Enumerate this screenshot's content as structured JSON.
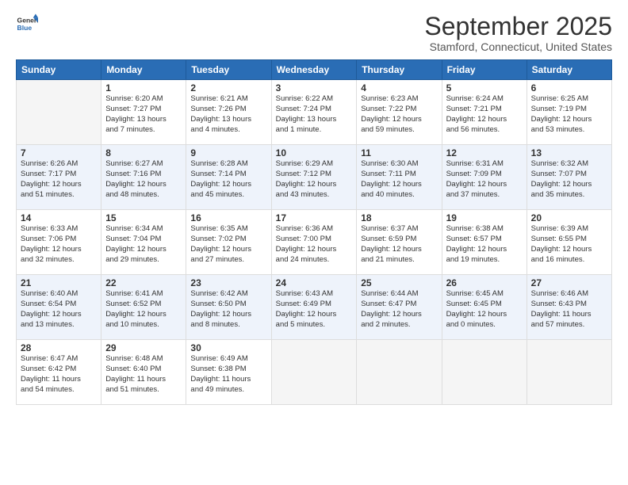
{
  "logo": {
    "line1": "General",
    "line2": "Blue"
  },
  "title": "September 2025",
  "subtitle": "Stamford, Connecticut, United States",
  "days_header": [
    "Sunday",
    "Monday",
    "Tuesday",
    "Wednesday",
    "Thursday",
    "Friday",
    "Saturday"
  ],
  "weeks": [
    [
      {
        "date": "",
        "info": ""
      },
      {
        "date": "1",
        "info": "Sunrise: 6:20 AM\nSunset: 7:27 PM\nDaylight: 13 hours\nand 7 minutes."
      },
      {
        "date": "2",
        "info": "Sunrise: 6:21 AM\nSunset: 7:26 PM\nDaylight: 13 hours\nand 4 minutes."
      },
      {
        "date": "3",
        "info": "Sunrise: 6:22 AM\nSunset: 7:24 PM\nDaylight: 13 hours\nand 1 minute."
      },
      {
        "date": "4",
        "info": "Sunrise: 6:23 AM\nSunset: 7:22 PM\nDaylight: 12 hours\nand 59 minutes."
      },
      {
        "date": "5",
        "info": "Sunrise: 6:24 AM\nSunset: 7:21 PM\nDaylight: 12 hours\nand 56 minutes."
      },
      {
        "date": "6",
        "info": "Sunrise: 6:25 AM\nSunset: 7:19 PM\nDaylight: 12 hours\nand 53 minutes."
      }
    ],
    [
      {
        "date": "7",
        "info": "Sunrise: 6:26 AM\nSunset: 7:17 PM\nDaylight: 12 hours\nand 51 minutes."
      },
      {
        "date": "8",
        "info": "Sunrise: 6:27 AM\nSunset: 7:16 PM\nDaylight: 12 hours\nand 48 minutes."
      },
      {
        "date": "9",
        "info": "Sunrise: 6:28 AM\nSunset: 7:14 PM\nDaylight: 12 hours\nand 45 minutes."
      },
      {
        "date": "10",
        "info": "Sunrise: 6:29 AM\nSunset: 7:12 PM\nDaylight: 12 hours\nand 43 minutes."
      },
      {
        "date": "11",
        "info": "Sunrise: 6:30 AM\nSunset: 7:11 PM\nDaylight: 12 hours\nand 40 minutes."
      },
      {
        "date": "12",
        "info": "Sunrise: 6:31 AM\nSunset: 7:09 PM\nDaylight: 12 hours\nand 37 minutes."
      },
      {
        "date": "13",
        "info": "Sunrise: 6:32 AM\nSunset: 7:07 PM\nDaylight: 12 hours\nand 35 minutes."
      }
    ],
    [
      {
        "date": "14",
        "info": "Sunrise: 6:33 AM\nSunset: 7:06 PM\nDaylight: 12 hours\nand 32 minutes."
      },
      {
        "date": "15",
        "info": "Sunrise: 6:34 AM\nSunset: 7:04 PM\nDaylight: 12 hours\nand 29 minutes."
      },
      {
        "date": "16",
        "info": "Sunrise: 6:35 AM\nSunset: 7:02 PM\nDaylight: 12 hours\nand 27 minutes."
      },
      {
        "date": "17",
        "info": "Sunrise: 6:36 AM\nSunset: 7:00 PM\nDaylight: 12 hours\nand 24 minutes."
      },
      {
        "date": "18",
        "info": "Sunrise: 6:37 AM\nSunset: 6:59 PM\nDaylight: 12 hours\nand 21 minutes."
      },
      {
        "date": "19",
        "info": "Sunrise: 6:38 AM\nSunset: 6:57 PM\nDaylight: 12 hours\nand 19 minutes."
      },
      {
        "date": "20",
        "info": "Sunrise: 6:39 AM\nSunset: 6:55 PM\nDaylight: 12 hours\nand 16 minutes."
      }
    ],
    [
      {
        "date": "21",
        "info": "Sunrise: 6:40 AM\nSunset: 6:54 PM\nDaylight: 12 hours\nand 13 minutes."
      },
      {
        "date": "22",
        "info": "Sunrise: 6:41 AM\nSunset: 6:52 PM\nDaylight: 12 hours\nand 10 minutes."
      },
      {
        "date": "23",
        "info": "Sunrise: 6:42 AM\nSunset: 6:50 PM\nDaylight: 12 hours\nand 8 minutes."
      },
      {
        "date": "24",
        "info": "Sunrise: 6:43 AM\nSunset: 6:49 PM\nDaylight: 12 hours\nand 5 minutes."
      },
      {
        "date": "25",
        "info": "Sunrise: 6:44 AM\nSunset: 6:47 PM\nDaylight: 12 hours\nand 2 minutes."
      },
      {
        "date": "26",
        "info": "Sunrise: 6:45 AM\nSunset: 6:45 PM\nDaylight: 12 hours\nand 0 minutes."
      },
      {
        "date": "27",
        "info": "Sunrise: 6:46 AM\nSunset: 6:43 PM\nDaylight: 11 hours\nand 57 minutes."
      }
    ],
    [
      {
        "date": "28",
        "info": "Sunrise: 6:47 AM\nSunset: 6:42 PM\nDaylight: 11 hours\nand 54 minutes."
      },
      {
        "date": "29",
        "info": "Sunrise: 6:48 AM\nSunset: 6:40 PM\nDaylight: 11 hours\nand 51 minutes."
      },
      {
        "date": "30",
        "info": "Sunrise: 6:49 AM\nSunset: 6:38 PM\nDaylight: 11 hours\nand 49 minutes."
      },
      {
        "date": "",
        "info": ""
      },
      {
        "date": "",
        "info": ""
      },
      {
        "date": "",
        "info": ""
      },
      {
        "date": "",
        "info": ""
      }
    ]
  ]
}
